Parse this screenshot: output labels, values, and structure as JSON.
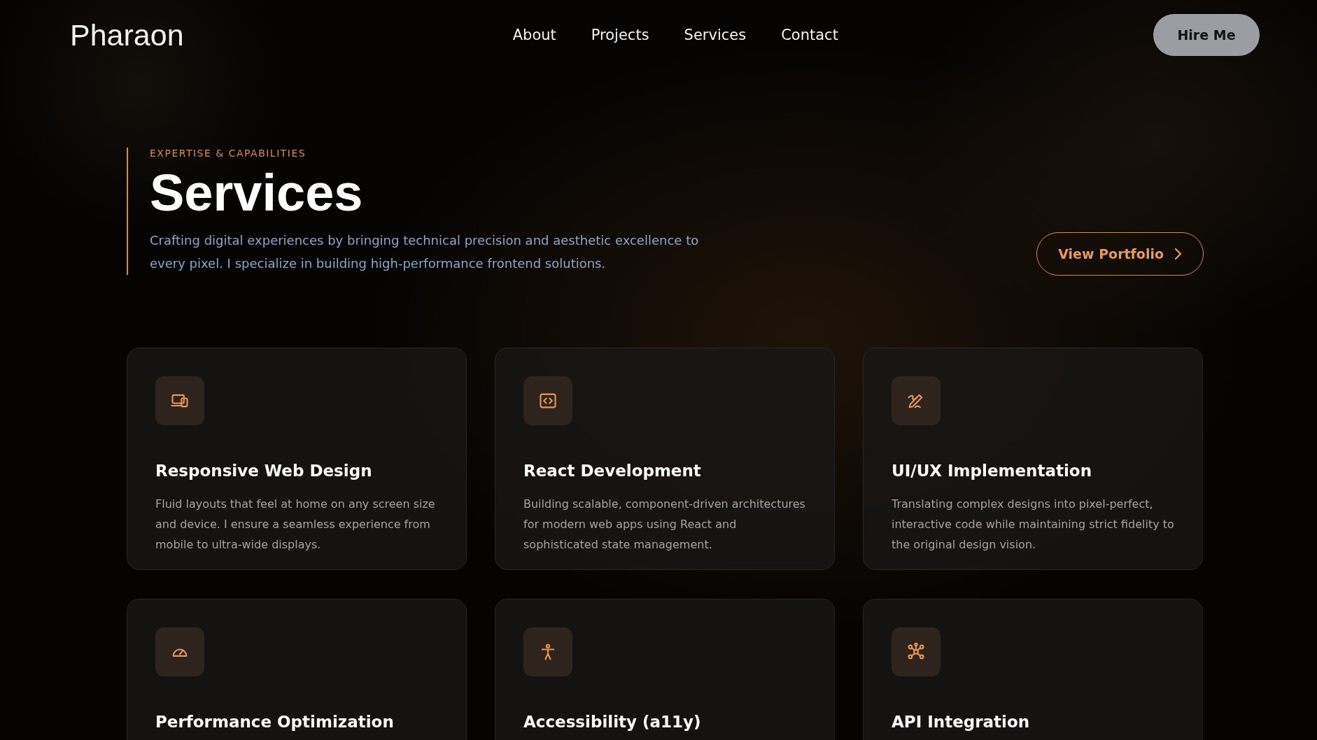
{
  "header": {
    "logo": "Pharaon",
    "nav": [
      {
        "label": "About"
      },
      {
        "label": "Projects"
      },
      {
        "label": "Services"
      },
      {
        "label": "Contact"
      }
    ],
    "cta": "Hire Me"
  },
  "hero": {
    "eyebrow": "EXPERTISE & CAPABILITIES",
    "title": "Services",
    "description": "Crafting digital experiences by bringing technical precision and aesthetic excellence to every pixel. I specialize in building high-performance frontend solutions.",
    "button": "View Portfolio"
  },
  "services": [
    {
      "title": "Responsive Web Design",
      "description": "Fluid layouts that feel at home on any screen size and device. I ensure a seamless experience from mobile to ultra-wide displays."
    },
    {
      "title": "React Development",
      "description": "Building scalable, component-driven architectures for modern web apps using React and sophisticated state management."
    },
    {
      "title": "UI/UX Implementation",
      "description": "Translating complex designs into pixel-perfect, interactive code while maintaining strict fidelity to the original design vision."
    },
    {
      "title": "Performance Optimization"
    },
    {
      "title": "Accessibility (a11y)"
    },
    {
      "title": "API Integration"
    }
  ]
}
